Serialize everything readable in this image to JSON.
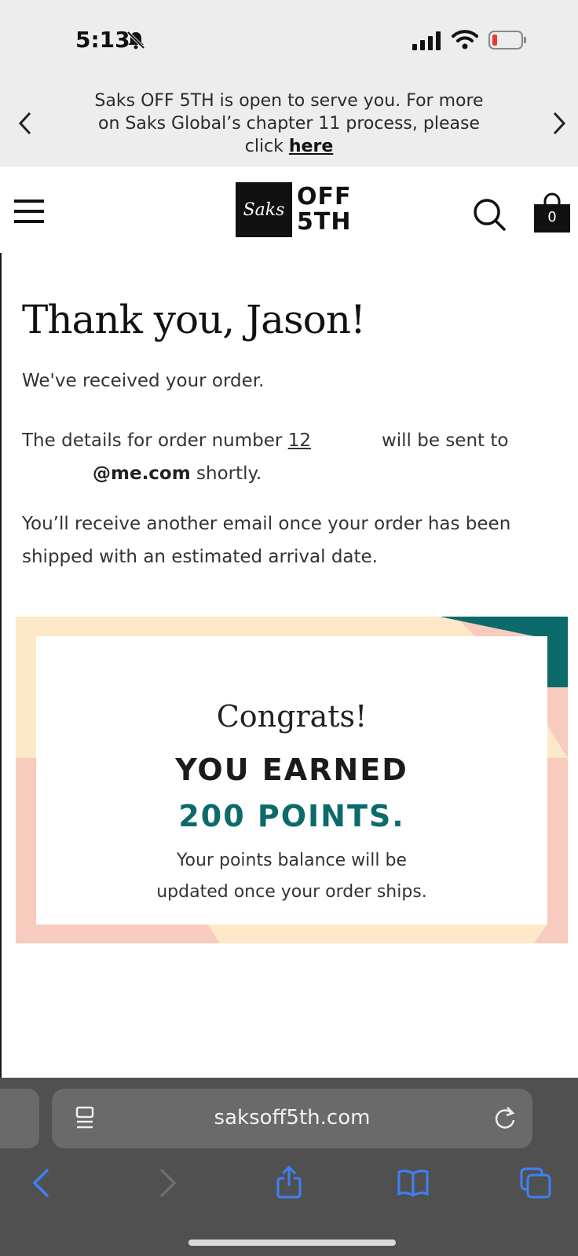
{
  "status_bar": {
    "time": "5:13"
  },
  "banner": {
    "text": "Saks OFF 5TH is open to serve you. For more on Saks Global’s chapter 11 process, please click",
    "link_text": "here"
  },
  "header": {
    "logo_mark": "Saks",
    "logo_line1": "OFF",
    "logo_line2": "5TH",
    "bag_count": "0"
  },
  "confirmation": {
    "title": "Thank you, Jason!",
    "received": "We've received your order.",
    "details_prefix": "The details for order number",
    "order_number_visible": "12",
    "details_suffix": "will be sent to",
    "email_visible": "@me.com",
    "email_suffix": "shortly.",
    "shipping_note": "You’ll receive another email once your order has been shipped with an estimated arrival date."
  },
  "points_card": {
    "congrats": "Congrats!",
    "earned": "YOU EARNED",
    "points": "200 POINTS.",
    "note": "Your points balance will be updated once your order ships."
  },
  "browser": {
    "url": "saksoff5th.com"
  },
  "colors": {
    "accent_teal": "#0c6b6a",
    "card_yellow": "#fde8c7",
    "card_pink": "#f7cbbd",
    "ios_blue": "#3b82f6"
  }
}
